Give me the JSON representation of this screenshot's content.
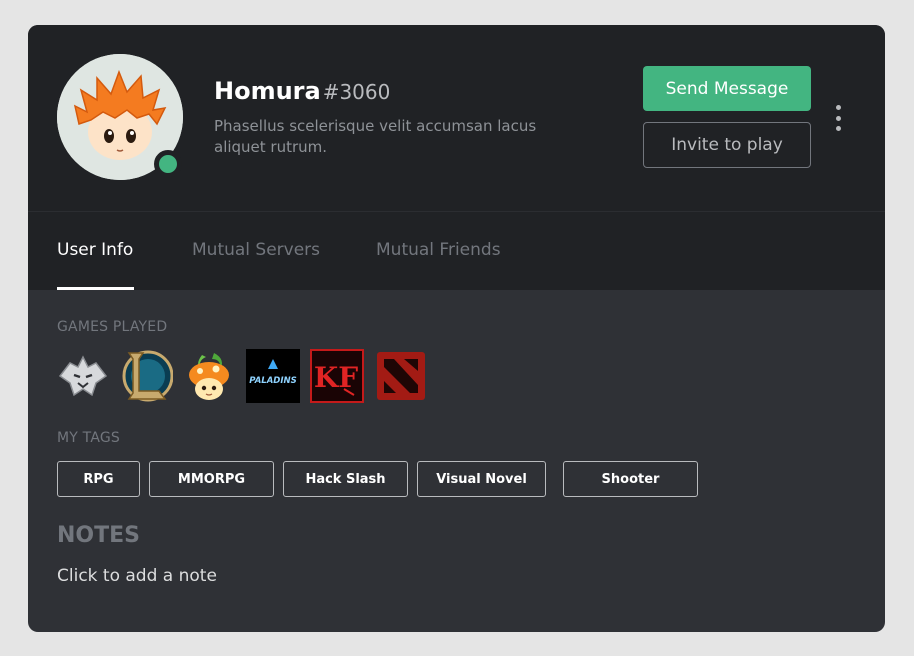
{
  "profile": {
    "username": "Homura",
    "discriminator": "#3060",
    "bio": "Phasellus scelerisque velit accumsan lacus aliquet rutrum.",
    "status": "online"
  },
  "actions": {
    "send_message": "Send Message",
    "invite_to_play": "Invite to play"
  },
  "tabs": [
    {
      "label": "User Info",
      "active": true
    },
    {
      "label": "Mutual Servers",
      "active": false
    },
    {
      "label": "Mutual Friends",
      "active": false
    }
  ],
  "games_played": {
    "title": "GAMES PLAYED",
    "games": [
      {
        "icon": "wolf-game-icon"
      },
      {
        "icon": "league-of-legends-icon"
      },
      {
        "icon": "mushroom-game-icon"
      },
      {
        "icon": "paladins-icon",
        "text": "PALADINS"
      },
      {
        "icon": "killing-floor-2-icon",
        "text": "KF"
      },
      {
        "icon": "dota-2-icon"
      }
    ]
  },
  "my_tags": {
    "title": "MY TAGS",
    "tags": [
      "RPG",
      "MMORPG",
      "Hack Slash",
      "Visual Novel",
      "Shooter"
    ]
  },
  "notes": {
    "title": "NOTES",
    "placeholder": "Click to add a note"
  },
  "colors": {
    "header_bg": "#202225",
    "body_bg": "#2f3136",
    "accent_green": "#43b581",
    "muted_text": "#72767d"
  }
}
